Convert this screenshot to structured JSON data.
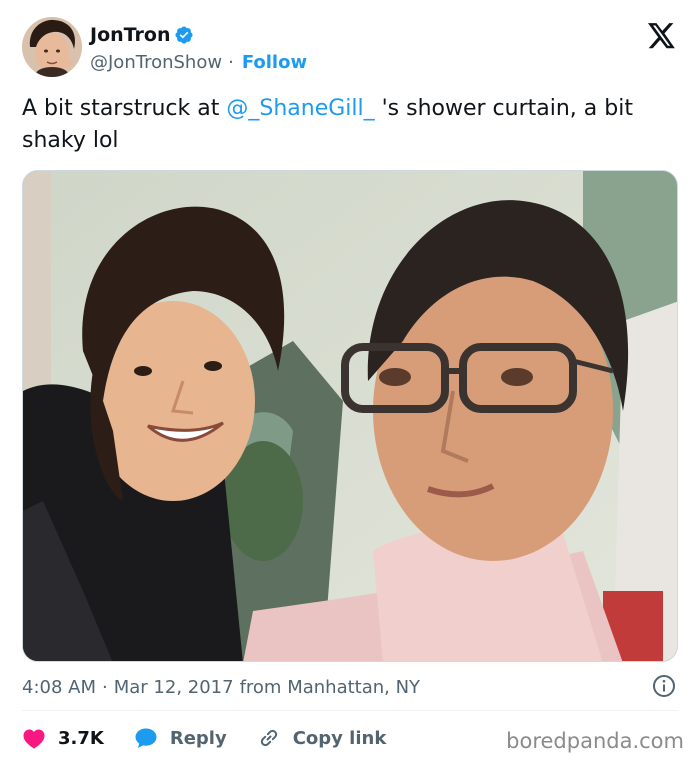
{
  "author": {
    "display_name": "JonTron",
    "handle": "@JonTronShow",
    "separator": "·",
    "follow_label": "Follow",
    "verified_icon": "verified-badge-icon",
    "verified_color": "#1d9bf0"
  },
  "platform_icon": "x-logo-icon",
  "tweet": {
    "text_before": "A bit starstruck at ",
    "mention": "@_ShaneGill_",
    "text_after": " 's shower curtain, a bit shaky lol",
    "mention_color": "#1d9bf0"
  },
  "meta": {
    "time": "4:08 AM",
    "separator": "·",
    "date": "Mar 12, 2017",
    "location": "from Manhattan, NY",
    "info_icon": "info-icon"
  },
  "actions": {
    "like_count": "3.7K",
    "like_icon": "heart-icon",
    "like_color": "#f91880",
    "reply_label": "Reply",
    "reply_icon": "speech-bubble-icon",
    "reply_color": "#1d9bf0",
    "copy_label": "Copy link",
    "copy_icon": "link-icon"
  },
  "watermark": "boredpanda.com"
}
